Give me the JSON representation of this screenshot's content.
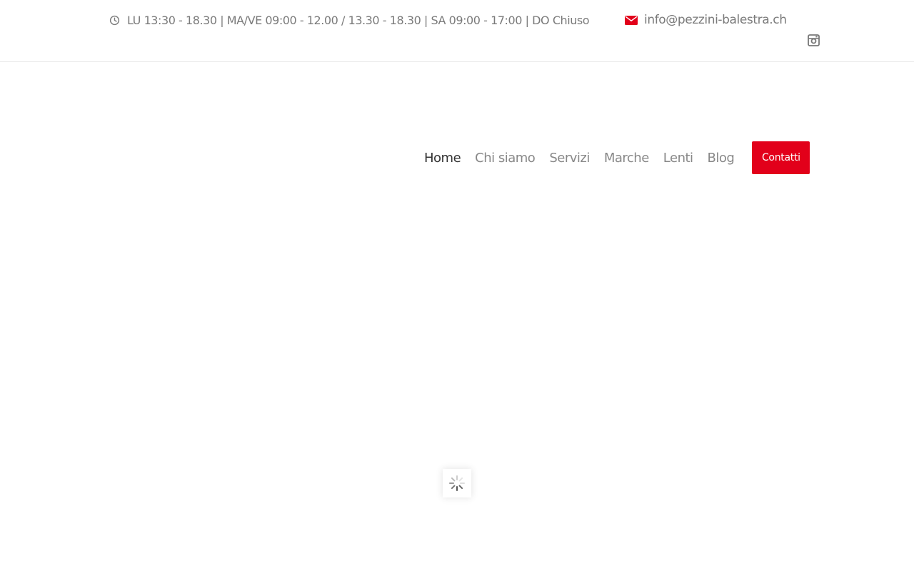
{
  "topbar": {
    "hours_icon": "clock-icon",
    "hours_text": "LU 13:30 - 18.30 | MA/VE 09:00 - 12.00 / 13.30 - 18.30 | SA 09:00 - 17:00 | DO Chiuso",
    "email_icon": "envelope-icon",
    "email": "info@pezzini-balestra.ch",
    "social_icon": "instagram-icon"
  },
  "nav": {
    "items": [
      {
        "label": "Home",
        "active": true
      },
      {
        "label": "Chi siamo",
        "active": false
      },
      {
        "label": "Servizi",
        "active": false
      },
      {
        "label": "Marche",
        "active": false
      },
      {
        "label": "Lenti",
        "active": false
      },
      {
        "label": "Blog",
        "active": false
      }
    ],
    "cta_label": "Contatti"
  },
  "loader": {
    "icon": "spinner-icon"
  },
  "colors": {
    "accent": "#e2001a",
    "text_muted": "#888888",
    "text_active": "#333333"
  }
}
